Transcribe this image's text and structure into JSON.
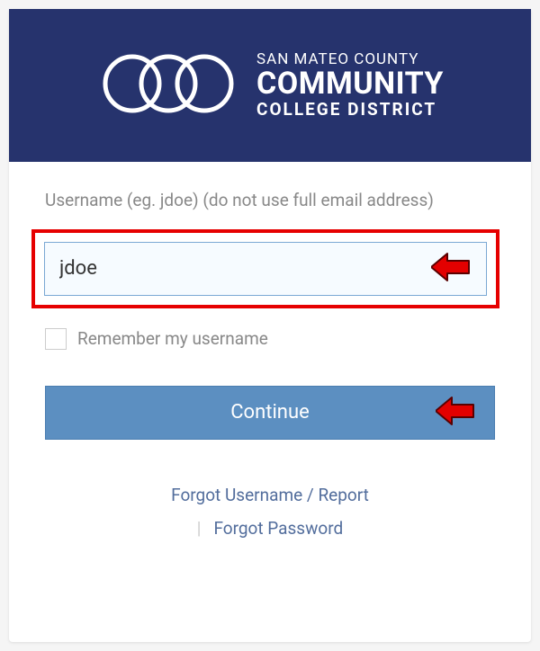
{
  "header": {
    "institution_line1": "SAN MATEO COUNTY",
    "institution_line2": "COMMUNITY",
    "institution_line3": "COLLEGE DISTRICT"
  },
  "form": {
    "username_label": "Username (eg. jdoe) (do not use full email address)",
    "username_value": "jdoe",
    "remember_label": "Remember my username",
    "continue_label": "Continue"
  },
  "links": {
    "forgot_username": "Forgot Username / Report",
    "forgot_password": "Forgot Password"
  },
  "annotations": {
    "arrow_color_fill": "#e30000",
    "arrow_color_stroke": "#5a0000",
    "highlight_color": "#e60000"
  }
}
